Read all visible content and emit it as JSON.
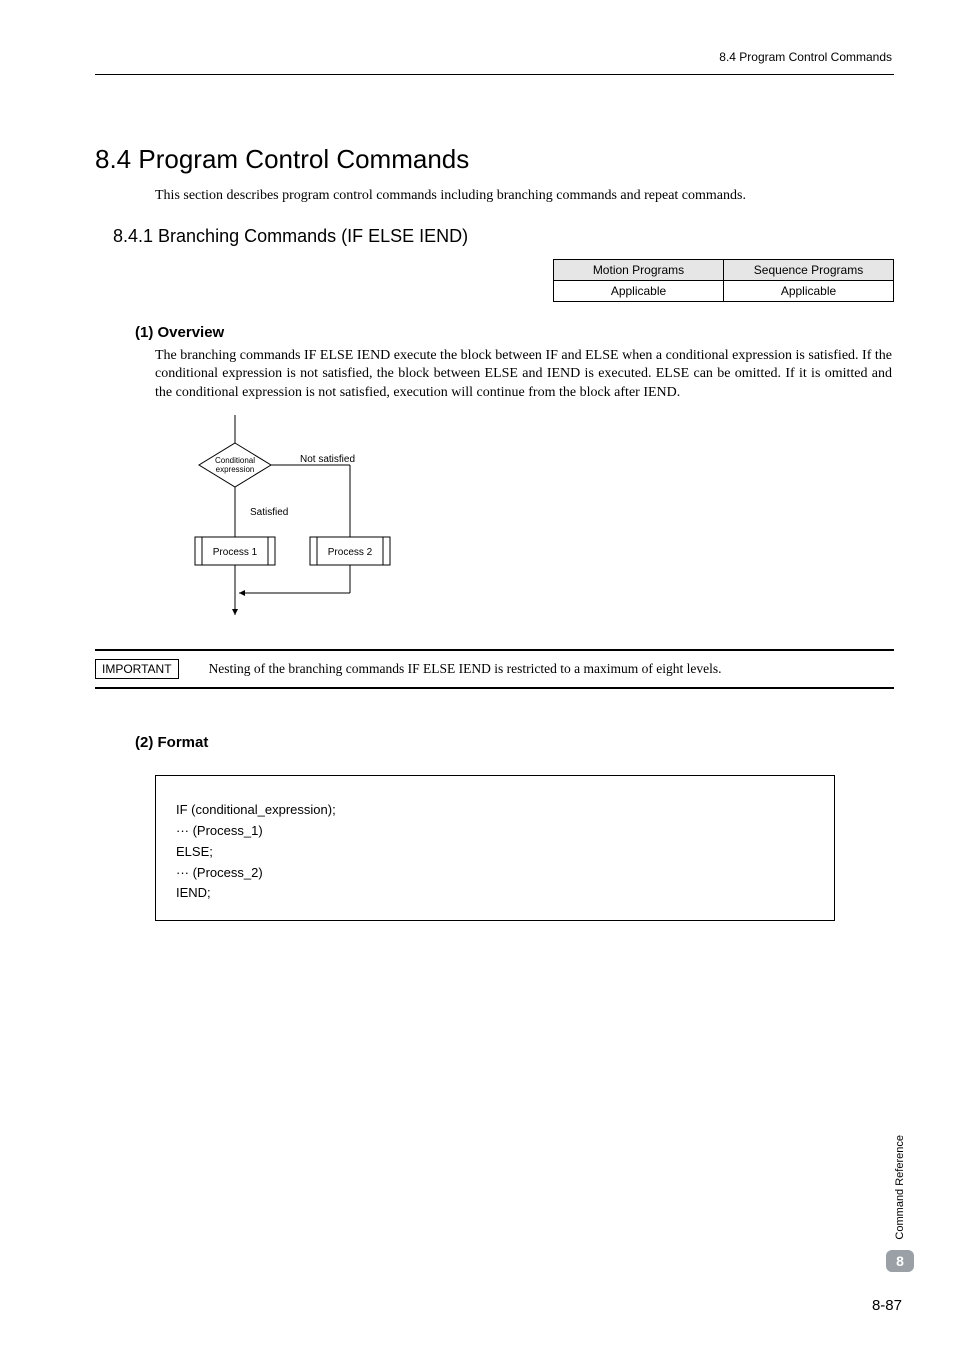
{
  "header": {
    "breadcrumb": "8.4  Program Control Commands"
  },
  "section": {
    "number": "8.4",
    "heading": "8.4  Program Control Commands",
    "description": "This section describes program control commands including branching commands and repeat commands."
  },
  "subsection": {
    "heading": "8.4.1  Branching Commands (IF ELSE IEND)"
  },
  "applicability": {
    "head_motion": "Motion Programs",
    "head_sequence": "Sequence Programs",
    "motion": "Applicable",
    "sequence": "Applicable"
  },
  "overview": {
    "title": "(1) Overview",
    "body": "The branching commands IF ELSE IEND execute the block between IF and ELSE when a conditional expression is satisfied. If the conditional expression is not satisfied, the block between ELSE and IEND is executed. ELSE can be omitted. If it is omitted and the conditional expression is not satisfied, execution will continue from the block after IEND."
  },
  "flowchart": {
    "conditional": "Conditional expression",
    "not_satisfied": "Not satisfied",
    "satisfied": "Satisfied",
    "process1": "Process 1",
    "process2": "Process 2"
  },
  "important": {
    "label": "IMPORTANT",
    "text": "Nesting of the branching commands IF ELSE IEND is restricted to a maximum of eight levels."
  },
  "format": {
    "title": "(2) Format",
    "lines": [
      "IF (conditional_expression);",
      " ··· (Process_1)",
      "ELSE;",
      " ··· (Process_2)",
      "IEND;"
    ]
  },
  "side": {
    "label": "Command Reference",
    "chapter": "8",
    "page": "8-87"
  }
}
